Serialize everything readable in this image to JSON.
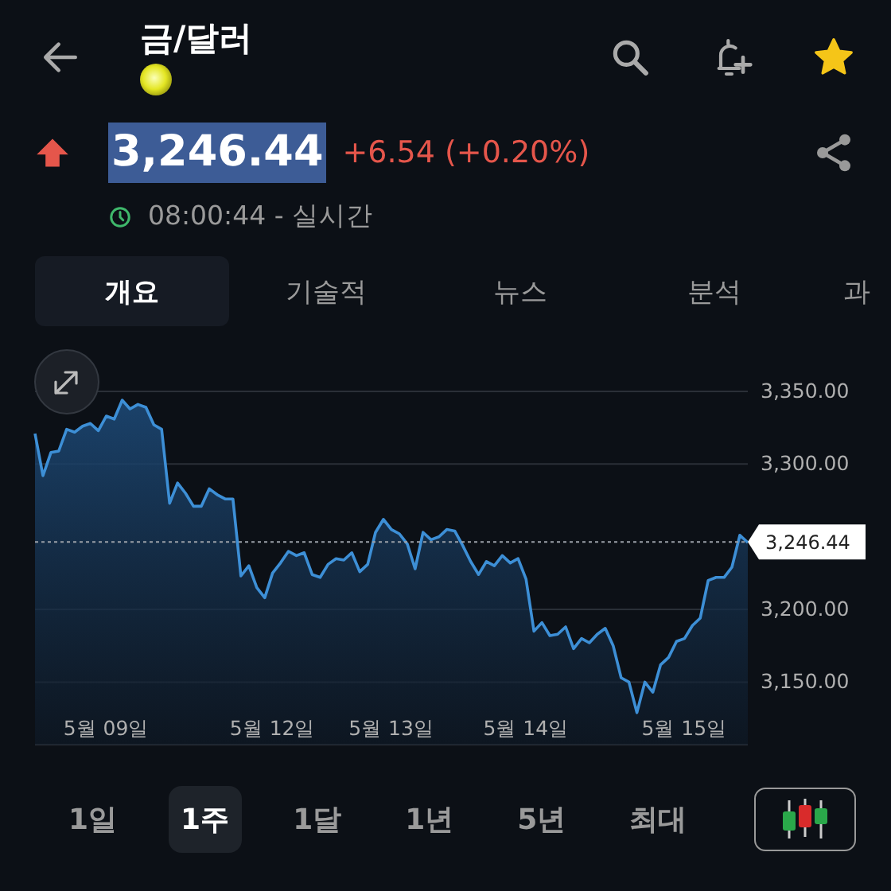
{
  "header": {
    "title": "금/달러",
    "favorite": true
  },
  "quote": {
    "rising": true,
    "price": "3,246.44",
    "price_selected": true,
    "change": "+6.54 (+0.20%)",
    "time": "08:00:44 - 실시간"
  },
  "tabs": [
    {
      "label": "개요",
      "selected": true
    },
    {
      "label": "기술적",
      "selected": false
    },
    {
      "label": "뉴스",
      "selected": false
    },
    {
      "label": "분석",
      "selected": false
    },
    {
      "label": "과",
      "selected": false
    }
  ],
  "chart": {
    "chart_data": {
      "type": "area",
      "grid": true,
      "categories": [
        null,
        null,
        null,
        null,
        null,
        null,
        null,
        null,
        null,
        "5월 09일",
        null,
        null,
        null,
        null,
        null,
        null,
        null,
        null,
        null,
        null,
        null,
        null,
        null,
        null,
        null,
        null,
        null,
        null,
        null,
        null,
        "5월 12일",
        null,
        null,
        null,
        null,
        null,
        null,
        null,
        null,
        null,
        null,
        null,
        null,
        null,
        null,
        "5월 13일",
        null,
        null,
        null,
        null,
        null,
        null,
        null,
        null,
        null,
        null,
        null,
        null,
        null,
        null,
        null,
        null,
        "5월 14일",
        null,
        null,
        null,
        null,
        null,
        null,
        null,
        null,
        null,
        null,
        null,
        null,
        null,
        null,
        null,
        null,
        null,
        null,
        null,
        "5월 15일",
        null,
        null,
        null,
        null,
        null,
        null,
        null,
        null
      ],
      "ylim": [
        3107,
        3350
      ],
      "series": [
        {
          "color": "#3d8fd6",
          "values": [
            3321,
            3292,
            3308,
            3309,
            3324,
            3322,
            3326,
            3328,
            3323,
            3333,
            3331,
            3344,
            3338,
            3341,
            3339,
            3327,
            3324,
            3273,
            3287,
            3280,
            3271,
            3271,
            3283,
            3279,
            3276,
            3276,
            3223,
            3230,
            3215,
            3208,
            3225,
            3232,
            3240,
            3237,
            3239,
            3224,
            3222,
            3231,
            3235,
            3234,
            3239,
            3226,
            3231,
            3253,
            3262,
            3255,
            3252,
            3245,
            3228,
            3253,
            3248,
            3250,
            3255,
            3254,
            3244,
            3233,
            3224,
            3233,
            3230,
            3237,
            3232,
            3235,
            3221,
            3185,
            3191,
            3182,
            3183,
            3188,
            3173,
            3180,
            3177,
            3183,
            3187,
            3175,
            3153,
            3150,
            3129,
            3150,
            3143,
            3162,
            3167,
            3178,
            3180,
            3189,
            3194,
            3220,
            3222,
            3222,
            3229,
            3251,
            3246
          ]
        }
      ],
      "yticks": [
        {
          "value": 3150,
          "label": "3,150.00"
        },
        {
          "value": 3200,
          "label": "3,200.00"
        },
        {
          "value": 3300,
          "label": "3,300.00"
        },
        {
          "value": 3350,
          "label": "3,350.00"
        }
      ],
      "ref_lines": [
        {
          "axis": "y",
          "value": 3246.44,
          "label": "3,246.44"
        }
      ]
    }
  },
  "periods": [
    {
      "label": "1일",
      "selected": false
    },
    {
      "label": "1주",
      "selected": true
    },
    {
      "label": "1달",
      "selected": false
    },
    {
      "label": "1년",
      "selected": false
    },
    {
      "label": "5년",
      "selected": false
    },
    {
      "label": "최대",
      "selected": false
    }
  ]
}
